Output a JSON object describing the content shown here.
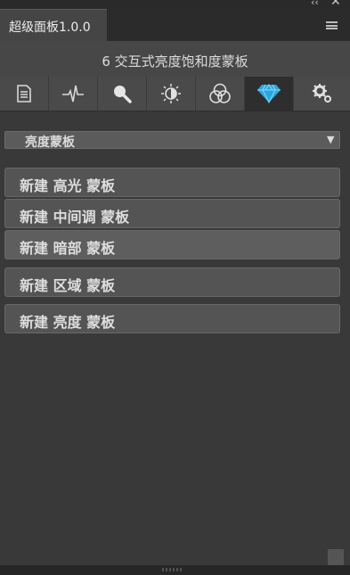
{
  "window": {
    "tab_title": "超级面板1.0.0"
  },
  "header": {
    "subtitle": "6 交互式亮度饱和度蒙板"
  },
  "toolbar": {
    "tools": [
      {
        "icon": "document-icon"
      },
      {
        "icon": "waveform-icon"
      },
      {
        "icon": "search-icon"
      },
      {
        "icon": "brightness-icon"
      },
      {
        "icon": "color-circles-icon"
      },
      {
        "icon": "diamond-icon",
        "active": true
      },
      {
        "icon": "settings-icon"
      }
    ]
  },
  "mask_select": {
    "value": "亮度蒙板"
  },
  "actions": [
    {
      "label": "新建 高光 蒙板"
    },
    {
      "label": "新建 中间调 蒙板"
    },
    {
      "label": "新建 暗部 蒙板"
    },
    {
      "label": "新建 区域 蒙板"
    },
    {
      "label": "新建 亮度 蒙板"
    }
  ],
  "colors": {
    "accent": "#2aa8e0",
    "panel_bg": "#393939",
    "button_bg": "#545454"
  }
}
